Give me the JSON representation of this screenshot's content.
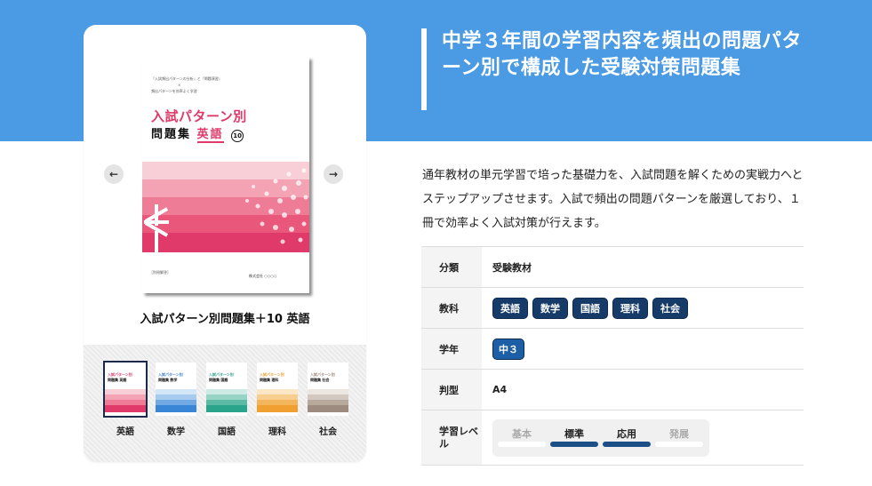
{
  "headline": "中学３年間の学習内容を頻出の問題パターン別で構成した受験対策問題集",
  "description": "通年教材の単元学習で培った基礎力を、入試問題を解くための実戦力へとステップアップさせます。入試で頻出の問題パターンを厳選しており、１冊で効率よく入試対策が行えます。",
  "product": {
    "title": "入試パターン別問題集＋10 英語",
    "cover": {
      "series_title": "入試パターン別",
      "series_sub": "問題集",
      "subject": "英語",
      "badge": "10"
    },
    "nav_prev_icon": "chevron-left-icon",
    "nav_next_icon": "chevron-right-icon"
  },
  "thumbnails": [
    {
      "label": "英語",
      "color": "#e03a6a",
      "active": true
    },
    {
      "label": "数学",
      "color": "#3a86d6",
      "active": false
    },
    {
      "label": "国語",
      "color": "#2aa48a",
      "active": false
    },
    {
      "label": "理科",
      "color": "#f0a030",
      "active": false
    },
    {
      "label": "社会",
      "color": "#9c8b7e",
      "active": false
    }
  ],
  "info": {
    "category_label": "分類",
    "category_value": "受験教材",
    "subject_label": "教科",
    "subjects": [
      "英語",
      "数学",
      "国語",
      "理科",
      "社会"
    ],
    "grade_label": "学年",
    "grade_value": "中３",
    "size_label": "判型",
    "size_value": "A4",
    "level_label": "学習レベル",
    "levels": [
      {
        "name": "基本",
        "active": false
      },
      {
        "name": "標準",
        "active": true
      },
      {
        "name": "応用",
        "active": true
      },
      {
        "name": "発展",
        "active": false
      }
    ]
  },
  "colors": {
    "brand_blue": "#4b9ae4",
    "tag_navy": "#163b69",
    "grade_blue": "#1d5fa6",
    "accent_pink": "#e03a6a"
  }
}
